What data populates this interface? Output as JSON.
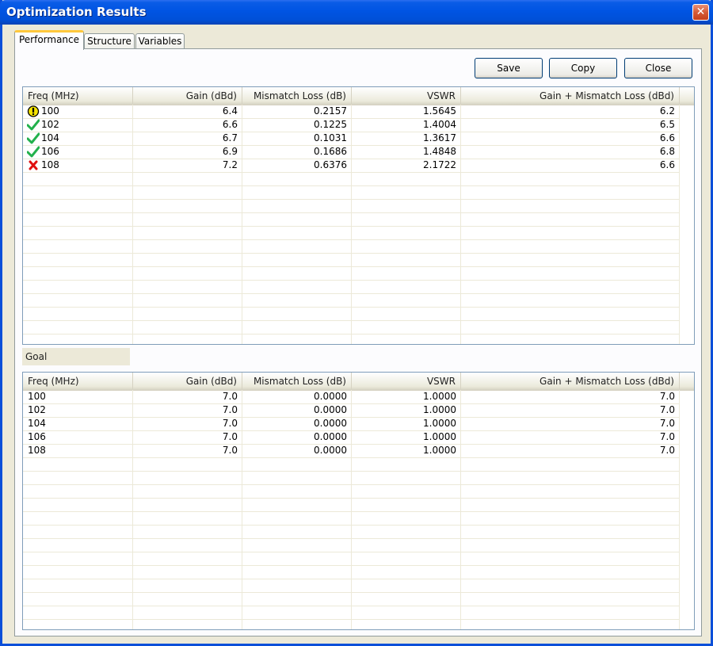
{
  "window": {
    "title": "Optimization Results",
    "close_glyph": "✕"
  },
  "tabs": [
    {
      "label": "Performance",
      "active": true
    },
    {
      "label": "Structure",
      "active": false
    },
    {
      "label": "Variables",
      "active": false
    }
  ],
  "buttons": {
    "save": "Save",
    "copy": "Copy",
    "close": "Close"
  },
  "columns": [
    "Freq (MHz)",
    "Gain (dBd)",
    "Mismatch Loss (dB)",
    "VSWR",
    "Gain + Mismatch Loss (dBd)"
  ],
  "results": [
    {
      "status": "warning-icon",
      "freq": "100",
      "gain": "6.4",
      "mismatch": "0.2157",
      "vswr": "1.5645",
      "total": "6.2"
    },
    {
      "status": "check-icon",
      "freq": "102",
      "gain": "6.6",
      "mismatch": "0.1225",
      "vswr": "1.4004",
      "total": "6.5"
    },
    {
      "status": "check-icon",
      "freq": "104",
      "gain": "6.7",
      "mismatch": "0.1031",
      "vswr": "1.3617",
      "total": "6.6"
    },
    {
      "status": "check-icon",
      "freq": "106",
      "gain": "6.9",
      "mismatch": "0.1686",
      "vswr": "1.4848",
      "total": "6.8"
    },
    {
      "status": "cross-icon",
      "freq": "108",
      "gain": "7.2",
      "mismatch": "0.6376",
      "vswr": "2.1722",
      "total": "6.6"
    }
  ],
  "goal_label": "Goal",
  "goals": [
    {
      "freq": "100",
      "gain": "7.0",
      "mismatch": "0.0000",
      "vswr": "1.0000",
      "total": "7.0"
    },
    {
      "freq": "102",
      "gain": "7.0",
      "mismatch": "0.0000",
      "vswr": "1.0000",
      "total": "7.0"
    },
    {
      "freq": "104",
      "gain": "7.0",
      "mismatch": "0.0000",
      "vswr": "1.0000",
      "total": "7.0"
    },
    {
      "freq": "106",
      "gain": "7.0",
      "mismatch": "0.0000",
      "vswr": "1.0000",
      "total": "7.0"
    },
    {
      "freq": "108",
      "gain": "7.0",
      "mismatch": "0.0000",
      "vswr": "1.0000",
      "total": "7.0"
    }
  ],
  "colors": {
    "ok": "#22b14c",
    "fail": "#e01010",
    "warn": "#f5e400"
  }
}
